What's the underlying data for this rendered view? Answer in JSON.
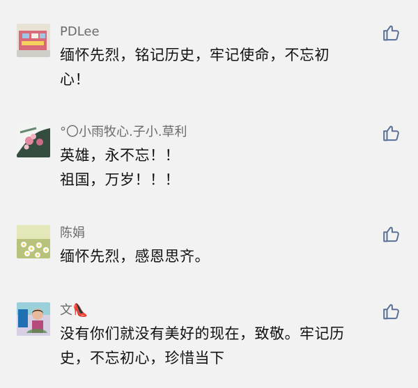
{
  "colors": {
    "background": "#f2f2f2",
    "name_text": "#6b6b6b",
    "comment_text": "#111111",
    "like_icon": "#5a6f94"
  },
  "comments": [
    {
      "name": "PDLee",
      "text": "缅怀先烈，铭记历史，牢记使命，不忘初\n心！",
      "avatar": "avatar-lego-toy",
      "like_icon": "thumbs-up-icon"
    },
    {
      "name": "°〇小雨牧心.子小.草利",
      "text": "英雄，永不忘！！\n祖国，万岁！！！",
      "avatar": "avatar-flowers",
      "like_icon": "thumbs-up-icon"
    },
    {
      "name": "陈娟",
      "text": "缅怀先烈，感恩思齐。",
      "avatar": "avatar-daisies",
      "like_icon": "thumbs-up-icon"
    },
    {
      "name": "文👠",
      "text": "没有你们就没有美好的现在，致敬。牢记历\n史，不忘初心，珍惜当下",
      "avatar": "avatar-child-photo",
      "like_icon": "thumbs-up-icon"
    }
  ]
}
